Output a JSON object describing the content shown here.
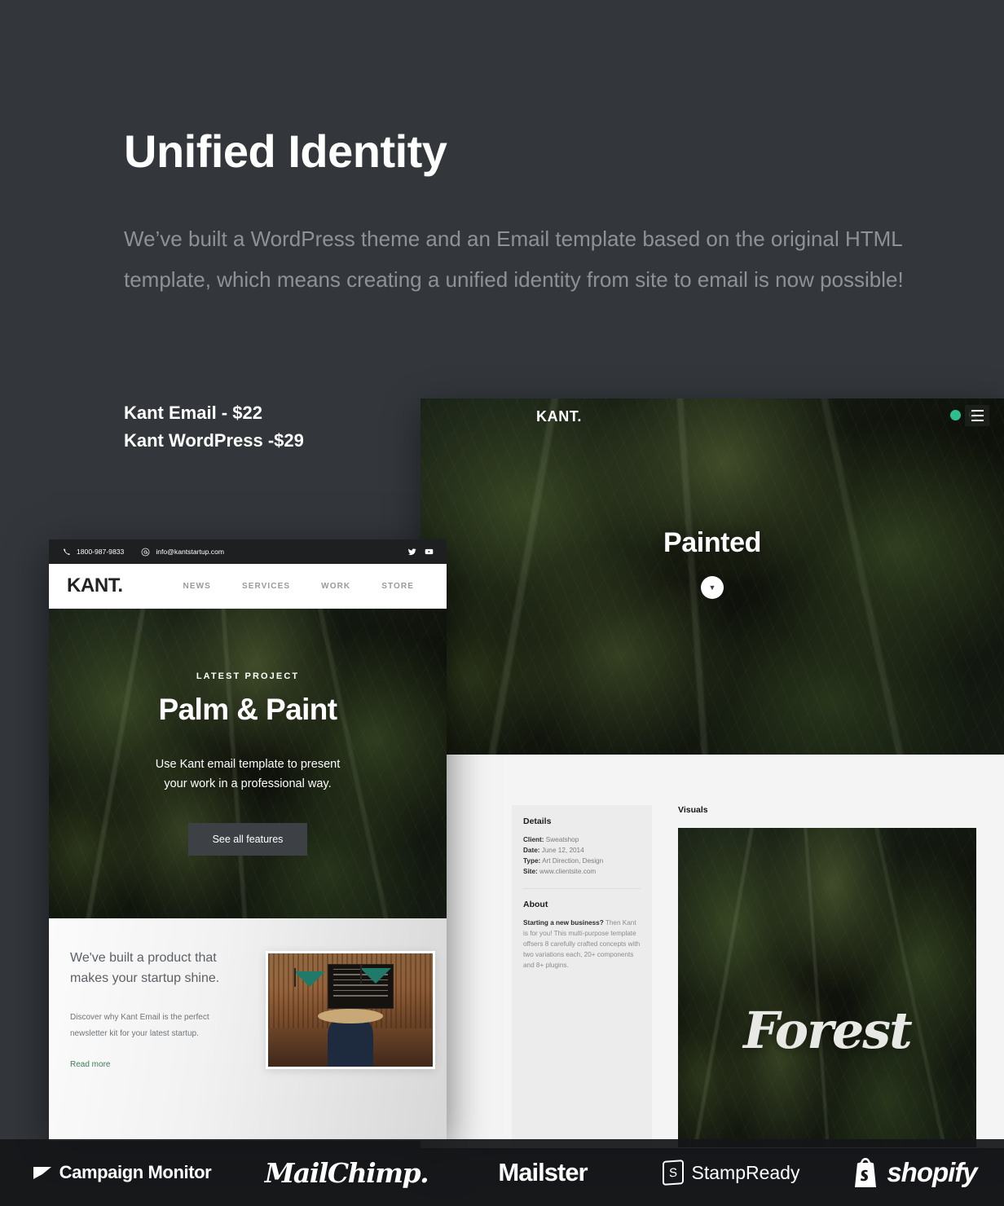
{
  "intro": {
    "headline": "Unified Identity",
    "paragraph": "We’ve built a WordPress theme and an Email template based on the original HTML template, which means creating a unified identity from site to email is now possible!",
    "price_email": "Kant Email - $22",
    "price_wordpress": "Kant WordPress -$29"
  },
  "colors": {
    "page_background": "#33373c",
    "heading_text": "#ffffff",
    "body_text": "#8e9196",
    "accent_green": "#2fbf8f",
    "link_green": "#3f7a56",
    "email_cta": "#3d4045",
    "footer_bar": "#141618"
  },
  "wordpress_mock": {
    "logo": "KANT.",
    "menu_icon": "hamburger-icon",
    "search_icon": "search-icon",
    "cart_badge_icon": "cart-badge-dot",
    "hero_title": "Painted",
    "scroll_button_icon": "chevron-down-icon",
    "details": {
      "heading": "Details",
      "rows": [
        {
          "label": "Client:",
          "value": "Sweatshop"
        },
        {
          "label": "Date:",
          "value": "June 12, 2014"
        },
        {
          "label": "Type:",
          "value": "Art Direction, Design"
        },
        {
          "label": "Site:",
          "value": "www.clientsite.com"
        }
      ],
      "about_heading": "About",
      "about_lead": "Starting a new business?",
      "about_body": " Then Kant is for you! This multi-purpose template offsers 8 carefully crafted concepts with two variations each, 20+ components and 8+ plugins."
    },
    "visuals": {
      "heading": "Visuals",
      "image_caption": "Forest"
    }
  },
  "email_mock": {
    "topbar": {
      "phone_icon": "phone-icon",
      "phone": "1800-987-9833",
      "email_icon": "at-sign-icon",
      "email": "info@kantstartup.com",
      "social": [
        {
          "name": "twitter-icon"
        },
        {
          "name": "youtube-icon"
        }
      ]
    },
    "logo": "KANT.",
    "menu": [
      "NEWS",
      "SERVICES",
      "WORK",
      "STORE"
    ],
    "hero": {
      "eyebrow": "LATEST PROJECT",
      "title": "Palm & Paint",
      "subtitle_line1": "Use Kant email template to present",
      "subtitle_line2": "your work in a professional way.",
      "cta_label": "See all features"
    },
    "promo": {
      "heading_line1": "We've built a product that",
      "heading_line2": "makes your startup shine.",
      "body_line1": "Discover why Kant Email is the perfect",
      "body_line2": "newsletter kit for your latest startup.",
      "link": "Read more",
      "image_alt": "cafe-interior-photo"
    }
  },
  "footer_logos": [
    {
      "name": "campaign-monitor-logo",
      "label": "Campaign Monitor"
    },
    {
      "name": "mailchimp-logo",
      "label": "MailChimp."
    },
    {
      "name": "mailster-logo",
      "label": "Mailster"
    },
    {
      "name": "stampready-logo",
      "label": "StampReady",
      "mark": "S"
    },
    {
      "name": "shopify-logo",
      "label": "shopify"
    }
  ]
}
